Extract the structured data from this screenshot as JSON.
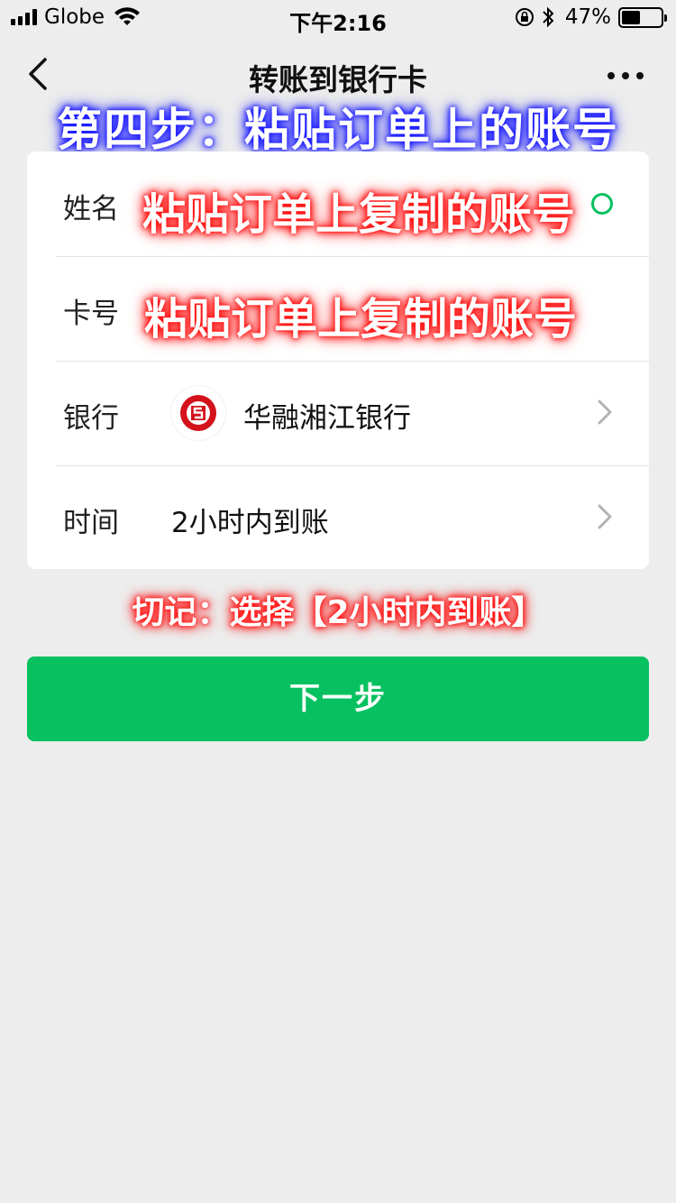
{
  "status_bar": {
    "carrier": "Globe",
    "time": "下午2:16",
    "battery_percent": "47%",
    "battery_level": 0.47
  },
  "nav": {
    "title": "转账到银行卡"
  },
  "overlays": {
    "step": "第四步：粘贴订单上的账号",
    "paste_name": "粘贴订单上复制的账号",
    "paste_card": "粘贴订单上复制的账号",
    "reminder": "切记：选择【2小时内到账】"
  },
  "form": {
    "name_label": "姓名",
    "card_label": "卡号",
    "bank_label": "银行",
    "bank_name": "华融湘江银行",
    "time_label": "时间",
    "time_value": "2小时内到账"
  },
  "next_button": "下一步",
  "colors": {
    "accent_green": "#07c160",
    "bank_red": "#d3121b"
  }
}
